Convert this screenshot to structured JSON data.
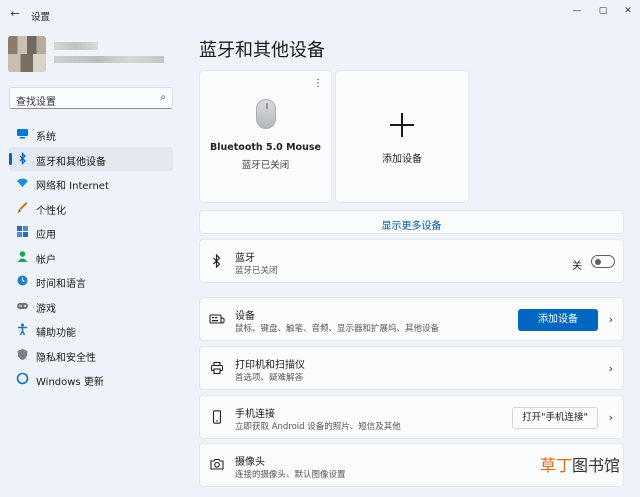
{
  "window": {
    "back": "←",
    "title": "设置",
    "minimize": "—",
    "maximize": "▢",
    "close": "✕"
  },
  "search": {
    "placeholder": "查找设置",
    "icon": "⌕"
  },
  "sidebar": {
    "items": [
      {
        "label": "系统",
        "icon": "system-icon",
        "color": "#0078d4"
      },
      {
        "label": "蓝牙和其他设备",
        "icon": "bluetooth-icon",
        "color": "#0067c0",
        "active": true
      },
      {
        "label": "网络和 Internet",
        "icon": "wifi-icon",
        "color": "#1a8fd6"
      },
      {
        "label": "个性化",
        "icon": "brush-icon",
        "color": "#c67a1c"
      },
      {
        "label": "应用",
        "icon": "apps-icon",
        "color": "#2b6bb5"
      },
      {
        "label": "帐户",
        "icon": "account-icon",
        "color": "#1fa35a"
      },
      {
        "label": "时间和语言",
        "icon": "clock-globe-icon",
        "color": "#1f7ec4"
      },
      {
        "label": "游戏",
        "icon": "gamepad-icon",
        "color": "#555"
      },
      {
        "label": "辅助功能",
        "icon": "accessibility-icon",
        "color": "#1b6fbf"
      },
      {
        "label": "隐私和安全性",
        "icon": "shield-icon",
        "color": "#6b6f75"
      },
      {
        "label": "Windows 更新",
        "icon": "update-icon",
        "color": "#0a73c9"
      }
    ]
  },
  "main": {
    "title": "蓝牙和其他设备",
    "device_card": {
      "more": "⋮",
      "name": "Bluetooth 5.0 Mouse",
      "status": "蓝牙已关闭"
    },
    "add_card": {
      "label": "添加设备"
    },
    "show_more": "显示更多设备",
    "rows": {
      "bluetooth": {
        "title": "蓝牙",
        "subtitle": "蓝牙已关闭",
        "toggle_label": "关",
        "toggle_on": false
      },
      "devices": {
        "title": "设备",
        "subtitle": "鼠标、键盘、触笔、音频、显示器和扩展坞、其他设备",
        "button": "添加设备"
      },
      "printers": {
        "title": "打印机和扫描仪",
        "subtitle": "首选项、疑难解答"
      },
      "phone": {
        "title": "手机连接",
        "subtitle": "立即获取 Android 设备的照片、短信及其他",
        "button": "打开\"手机连接\""
      },
      "camera": {
        "title": "摄像头",
        "subtitle": "连接的摄像头、默认图像设置"
      }
    },
    "chevron": "›"
  },
  "watermark": {
    "brand": "草丁",
    "suffix": "图书馆"
  }
}
